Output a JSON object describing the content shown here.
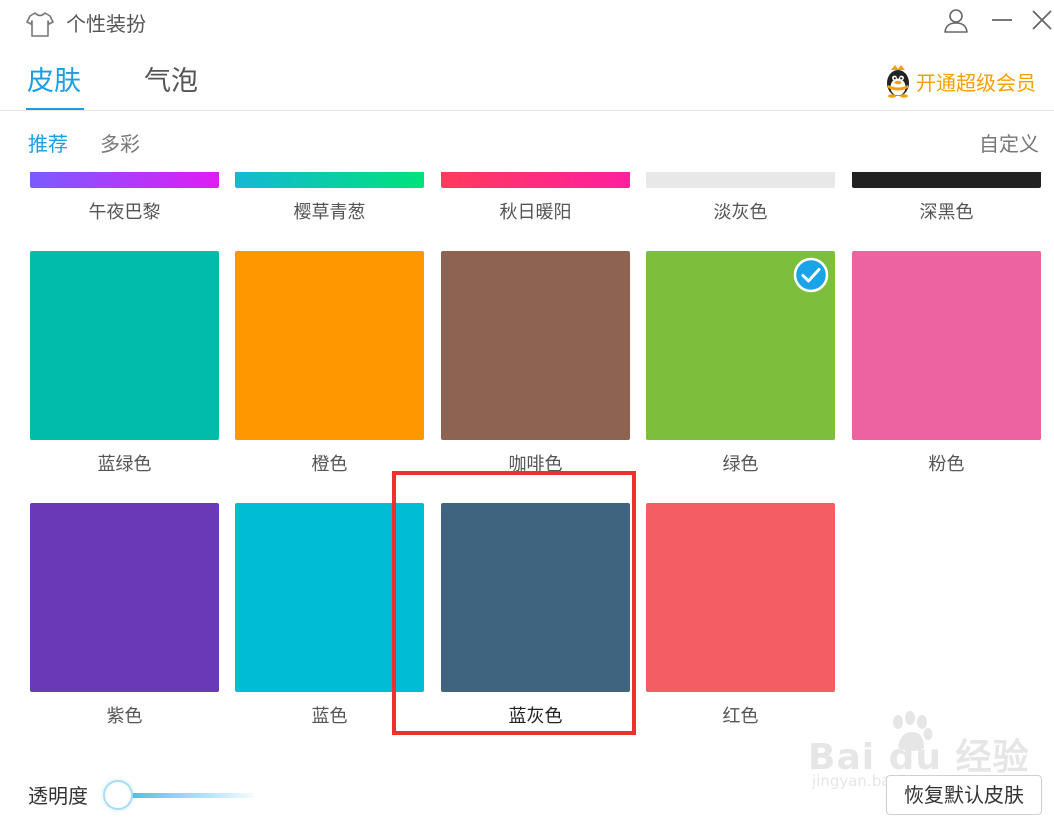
{
  "window": {
    "title": "个性装扮",
    "icons": [
      "tshirt-icon",
      "user-icon",
      "minimize-icon",
      "close-icon"
    ]
  },
  "tabs": {
    "skin": "皮肤",
    "bubble": "气泡",
    "active": "皮肤"
  },
  "vip": {
    "label": "开通超级会员",
    "icon": "qq-penguin-icon",
    "color": "#f5a000"
  },
  "subtabs": {
    "recommend": "推荐",
    "colorful": "多彩",
    "active": "推荐",
    "custom": "自定义"
  },
  "accent_color": "#1a9ee6",
  "skins": {
    "row1": [
      {
        "label": "午夜巴黎",
        "gradient": [
          "#7a5cff",
          "#e01cf5"
        ]
      },
      {
        "label": "樱草青葱",
        "gradient": [
          "#14b8d4",
          "#00e27a"
        ]
      },
      {
        "label": "秋日暖阳",
        "gradient": [
          "#ff3b5c",
          "#ff1fa0"
        ]
      },
      {
        "label": "淡灰色",
        "color": "#e8e8e8"
      },
      {
        "label": "深黑色",
        "color": "#222222"
      }
    ],
    "row2": [
      {
        "label": "蓝绿色",
        "color": "#00bca8"
      },
      {
        "label": "橙色",
        "color": "#ff9800"
      },
      {
        "label": "咖啡色",
        "color": "#8d6351"
      },
      {
        "label": "绿色",
        "color": "#7bbf3c",
        "selected": true
      },
      {
        "label": "粉色",
        "color": "#ed62a0"
      }
    ],
    "row3": [
      {
        "label": "紫色",
        "color": "#683ab7"
      },
      {
        "label": "蓝色",
        "color": "#00bcd4"
      },
      {
        "label": "蓝灰色",
        "color": "#3f6480",
        "highlighted": true
      },
      {
        "label": "红色",
        "color": "#f45e62"
      }
    ]
  },
  "highlight_color": "#ee3030",
  "opacity": {
    "label": "透明度",
    "value_fraction": 0.0
  },
  "restore_button": "恢复默认皮肤",
  "watermark": {
    "line1": "Bai du 经验",
    "line2": "jingyan.baidu.com"
  }
}
